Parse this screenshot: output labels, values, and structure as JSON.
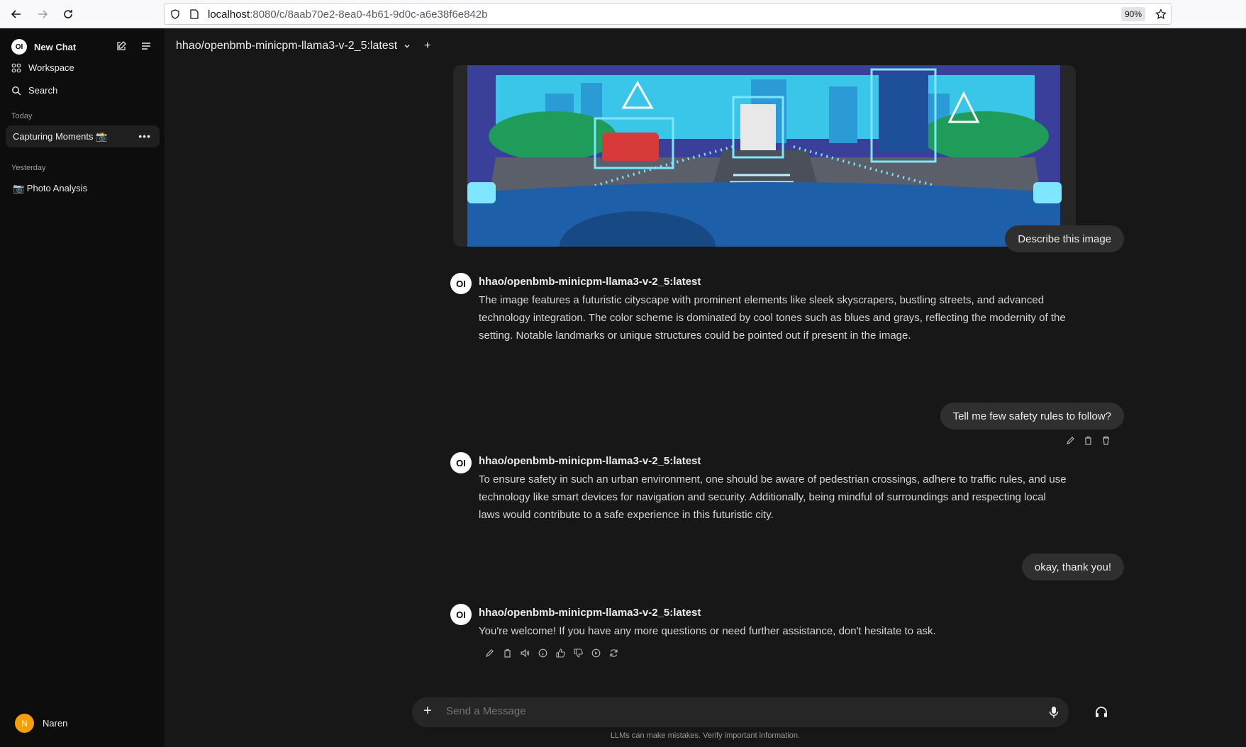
{
  "browser": {
    "url_host": "localhost",
    "url_path": ":8080/c/8aab70e2-8ea0-4b61-9d0c-a6e38f6e842b",
    "zoom": "90%"
  },
  "sidebar": {
    "new_chat": "New Chat",
    "workspace": "Workspace",
    "search": "Search",
    "today_label": "Today",
    "yesterday_label": "Yesterday",
    "chats_today": [
      {
        "label": "Capturing Moments 📸"
      }
    ],
    "chats_yesterday": [
      {
        "label": "📷 Photo Analysis"
      }
    ],
    "logo": "OI",
    "user": {
      "initial": "N",
      "name": "Naren"
    }
  },
  "main": {
    "model_name": "hhao/openbmb-minicpm-llama3-v-2_5:latest",
    "messages": [
      {
        "role": "user",
        "text": "Describe this image"
      },
      {
        "role": "assistant",
        "name": "hhao/openbmb-minicpm-llama3-v-2_5:latest",
        "text": "The image features a futuristic cityscape with prominent elements like sleek skyscrapers, bustling streets, and advanced technology integration. The color scheme is dominated by cool tones such as blues and grays, reflecting the modernity of the setting. Notable landmarks or unique structures could be pointed out if present in the image."
      },
      {
        "role": "user",
        "text": "Tell me few safety rules to follow?"
      },
      {
        "role": "assistant",
        "name": "hhao/openbmb-minicpm-llama3-v-2_5:latest",
        "text": "To ensure safety in such an urban environment, one should be aware of pedestrian crossings, adhere to traffic rules, and use technology like smart devices for navigation and security. Additionally, being mindful of surroundings and respecting local laws would contribute to a safe experience in this futuristic city."
      },
      {
        "role": "user",
        "text": "okay, thank you!"
      },
      {
        "role": "assistant",
        "name": "hhao/openbmb-minicpm-llama3-v-2_5:latest",
        "text": "You're welcome! If you have any more questions or need further assistance, don't hesitate to ask."
      }
    ],
    "composer_placeholder": "Send a Message",
    "disclaimer": "LLMs can make mistakes. Verify important information."
  },
  "colors": {
    "accent_avatar": "#f59e0b",
    "sidebar_bg": "#0d0d0d",
    "main_bg": "#171717",
    "bubble_bg": "#2f2f2f"
  }
}
